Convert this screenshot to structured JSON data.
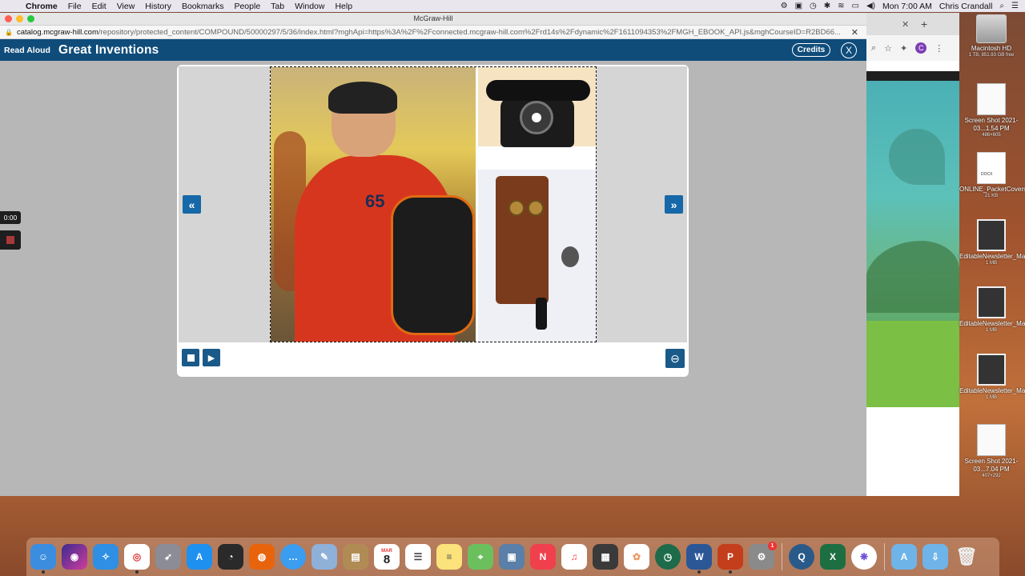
{
  "menubar": {
    "app": "Chrome",
    "items": [
      "File",
      "Edit",
      "View",
      "History",
      "Bookmarks",
      "People",
      "Tab",
      "Window",
      "Help"
    ],
    "clock": "Mon 7:00 AM",
    "user": "Chris Crandall"
  },
  "window": {
    "title": "McGraw-Hill",
    "url_domain": "catalog.mcgraw-hill.com",
    "url_path": "/repository/protected_content/COMPOUND/50000297/5/36/index.html?mghApi=https%3A%2F%2Fconnected.mcgraw-hill.com%2Frd14s%2Fdynamic%2F1611094353%2FMGH_EBOOK_API.js&mghCourseID=R2BD66..."
  },
  "app": {
    "read_aloud": "Read Aloud",
    "title": "Great Inventions",
    "credits": "Credits",
    "close": "X"
  },
  "recorder": {
    "timer": "0:00"
  },
  "reader": {
    "prev": "«",
    "next": "»",
    "shirt_number": "65"
  },
  "bgwindow": {
    "avatar": "C"
  },
  "desktop": [
    {
      "name": "Macintosh HD",
      "sub": "1 TB, 851.93 GB free",
      "kind": "hd"
    },
    {
      "name": "Screen Shot 2021-03...1.54 PM",
      "sub": "486×605",
      "kind": "shot"
    },
    {
      "name": "ONLINE_PacketCovers_March8",
      "sub": "21 KB",
      "kind": "doc",
      "tag": "DOCX"
    },
    {
      "name": "EditableNewsletter_March2...021.pptx",
      "sub": "1 MB",
      "kind": "ppt"
    },
    {
      "name": "EditableNewsletter_March1...021.pptx",
      "sub": "1 MB",
      "kind": "ppt"
    },
    {
      "name": "EditableNewsletter_March8...021.pptx",
      "sub": "1 MB",
      "kind": "ppt"
    },
    {
      "name": "Screen Shot 2021-03...7.04 PM",
      "sub": "407×292",
      "kind": "shot"
    }
  ],
  "dock": {
    "calendar_month": "MAR",
    "calendar_day": "8",
    "settings_badge": "1",
    "apps": [
      "finder",
      "siri",
      "safari",
      "chrome",
      "launchpad",
      "app-store",
      "dashboard",
      "firefox",
      "messenger",
      "preview",
      "notes-book",
      "calendar",
      "reminders",
      "notes",
      "maps",
      "photo-booth",
      "news",
      "music",
      "photo-editor",
      "photos",
      "time-machine",
      "word",
      "powerpoint",
      "system-preferences",
      "quicktime",
      "excel",
      "unknown-app",
      "applications-folder",
      "downloads-folder",
      "trash"
    ],
    "colors": {
      "finder": "#3b8de0",
      "word": "#2b5797",
      "powerpoint": "#c43e1c",
      "excel": "#1d6f42",
      "chrome": "#ffffff",
      "firefox": "#e8640c"
    }
  }
}
